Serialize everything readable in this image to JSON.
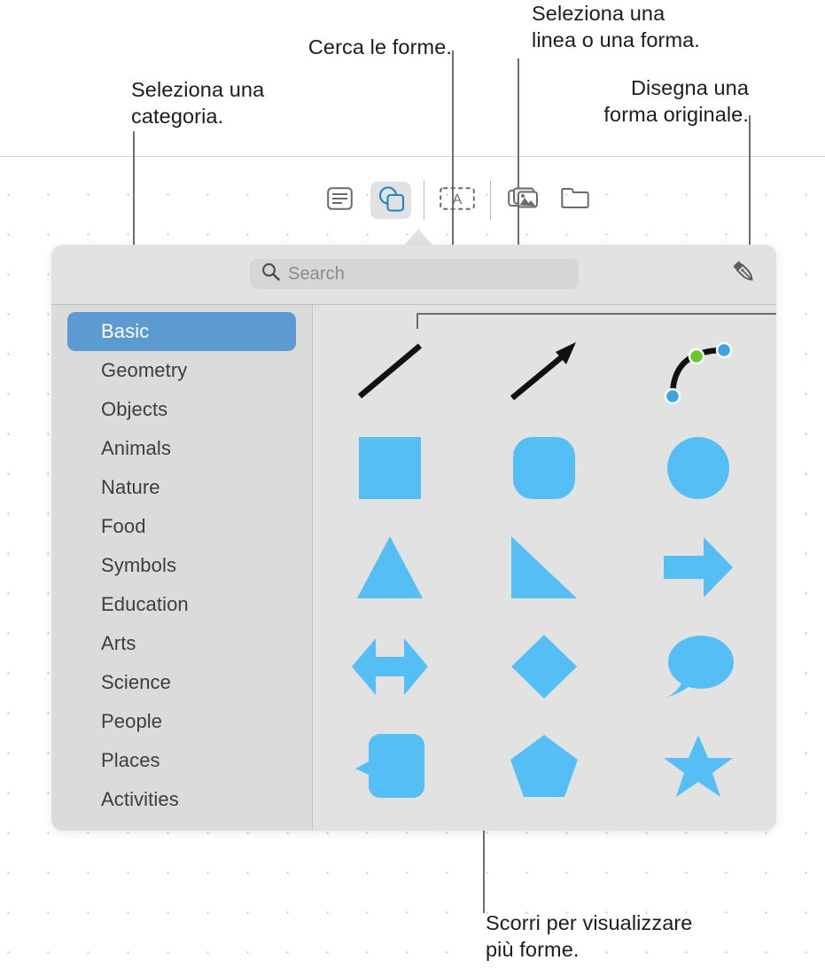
{
  "callouts": {
    "category": "Seleziona una\ncategoria.",
    "search": "Cerca le forme.",
    "line_or_shape": "Seleziona una\nlinea o una forma.",
    "draw": "Disegna una\nforma originale.",
    "scroll": "Scorri per visualizzare\npiù forme."
  },
  "toolbar": {
    "items": [
      {
        "name": "text-box-icon",
        "label": "Casella di testo",
        "selected": false
      },
      {
        "name": "shapes-icon",
        "label": "Forma",
        "selected": true
      },
      {
        "name": "text-art-icon",
        "label": "Testo grafico",
        "selected": false
      },
      {
        "name": "media-icon",
        "label": "Media",
        "selected": false
      },
      {
        "name": "folder-icon",
        "label": "Cartella",
        "selected": false
      }
    ]
  },
  "popover": {
    "search": {
      "placeholder": "Search",
      "value": "",
      "icon": "search-icon"
    },
    "draw_button": {
      "icon": "pen-nib-icon",
      "label": "Disegna"
    },
    "categories": [
      {
        "label": "Basic",
        "selected": true
      },
      {
        "label": "Geometry",
        "selected": false
      },
      {
        "label": "Objects",
        "selected": false
      },
      {
        "label": "Animals",
        "selected": false
      },
      {
        "label": "Nature",
        "selected": false
      },
      {
        "label": "Food",
        "selected": false
      },
      {
        "label": "Symbols",
        "selected": false
      },
      {
        "label": "Education",
        "selected": false
      },
      {
        "label": "Arts",
        "selected": false
      },
      {
        "label": "Science",
        "selected": false
      },
      {
        "label": "People",
        "selected": false
      },
      {
        "label": "Places",
        "selected": false
      },
      {
        "label": "Activities",
        "selected": false
      }
    ],
    "shapes": [
      [
        {
          "name": "line-shape",
          "label": "Linea"
        },
        {
          "name": "arrow-line-shape",
          "label": "Linea con freccia"
        },
        {
          "name": "curved-line-shape",
          "label": "Linea curva"
        }
      ],
      [
        {
          "name": "square-shape",
          "label": "Quadrato"
        },
        {
          "name": "rounded-square-shape",
          "label": "Quadrato arrotondato"
        },
        {
          "name": "circle-shape",
          "label": "Cerchio"
        }
      ],
      [
        {
          "name": "triangle-shape",
          "label": "Triangolo"
        },
        {
          "name": "right-triangle-shape",
          "label": "Triangolo rettangolo"
        },
        {
          "name": "right-arrow-shape",
          "label": "Freccia destra"
        }
      ],
      [
        {
          "name": "double-arrow-shape",
          "label": "Freccia doppia"
        },
        {
          "name": "diamond-shape",
          "label": "Rombo"
        },
        {
          "name": "speech-bubble-oval-shape",
          "label": "Fumetto ovale"
        }
      ],
      [
        {
          "name": "speech-bubble-rect-shape",
          "label": "Fumetto rettangolare"
        },
        {
          "name": "pentagon-shape",
          "label": "Pentagono"
        },
        {
          "name": "star-shape",
          "label": "Stella"
        }
      ]
    ]
  },
  "colors": {
    "shape_fill": "#55BFF5",
    "selection_blue": "#5B9BD1",
    "popover_bg": "#E3E2E2",
    "sidebar_bg": "#DCDBDB",
    "handle_blue": "#3DA5E0",
    "handle_green": "#65C92E",
    "leader_line": "#6E6E6E"
  }
}
